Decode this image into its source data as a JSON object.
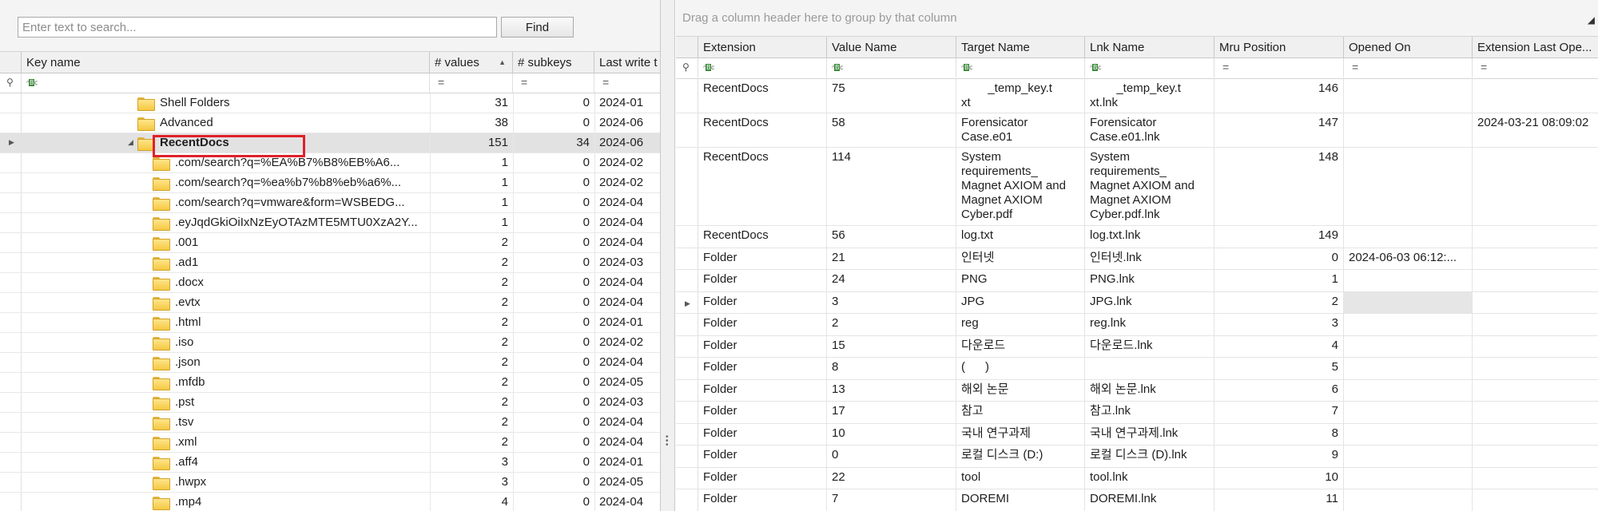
{
  "search": {
    "placeholder": "Enter text to search...",
    "find_label": "Find"
  },
  "left_grid": {
    "columns": [
      "Key name",
      "# values",
      "# subkeys",
      "Last write t"
    ],
    "rows": [
      {
        "name": "Shell Folders",
        "values": "31",
        "subkeys": "0",
        "date": "2024-01"
      },
      {
        "name": "Advanced",
        "values": "38",
        "subkeys": "0",
        "date": "2024-06"
      },
      {
        "name": "RecentDocs",
        "values": "151",
        "subkeys": "34",
        "date": "2024-06"
      },
      {
        "name": ".com/search?q=%EA%B7%B8%EB%A6...",
        "values": "1",
        "subkeys": "0",
        "date": "2024-02"
      },
      {
        "name": ".com/search?q=%ea%b7%b8%eb%a6%...",
        "values": "1",
        "subkeys": "0",
        "date": "2024-02"
      },
      {
        "name": ".com/search?q=vmware&form=WSBEDG...",
        "values": "1",
        "subkeys": "0",
        "date": "2024-04"
      },
      {
        "name": ".eyJqdGkiOiIxNzEyOTAzMTE5MTU0XzA2Y...",
        "values": "1",
        "subkeys": "0",
        "date": "2024-04"
      },
      {
        "name": ".001",
        "values": "2",
        "subkeys": "0",
        "date": "2024-04"
      },
      {
        "name": ".ad1",
        "values": "2",
        "subkeys": "0",
        "date": "2024-03"
      },
      {
        "name": ".docx",
        "values": "2",
        "subkeys": "0",
        "date": "2024-04"
      },
      {
        "name": ".evtx",
        "values": "2",
        "subkeys": "0",
        "date": "2024-04"
      },
      {
        "name": ".html",
        "values": "2",
        "subkeys": "0",
        "date": "2024-01"
      },
      {
        "name": ".iso",
        "values": "2",
        "subkeys": "0",
        "date": "2024-02"
      },
      {
        "name": ".json",
        "values": "2",
        "subkeys": "0",
        "date": "2024-04"
      },
      {
        "name": ".mfdb",
        "values": "2",
        "subkeys": "0",
        "date": "2024-05"
      },
      {
        "name": ".pst",
        "values": "2",
        "subkeys": "0",
        "date": "2024-03"
      },
      {
        "name": ".tsv",
        "values": "2",
        "subkeys": "0",
        "date": "2024-04"
      },
      {
        "name": ".xml",
        "values": "2",
        "subkeys": "0",
        "date": "2024-04"
      },
      {
        "name": ".aff4",
        "values": "3",
        "subkeys": "0",
        "date": "2024-01"
      },
      {
        "name": ".hwpx",
        "values": "3",
        "subkeys": "0",
        "date": "2024-05"
      },
      {
        "name": ".mp4",
        "values": "4",
        "subkeys": "0",
        "date": "2024-04"
      }
    ]
  },
  "right_grid": {
    "group_hint": "Drag a column header here to group by that column",
    "columns": [
      "Extension",
      "Value Name",
      "Target Name",
      "Lnk Name",
      "Mru Position",
      "Opened On",
      "Extension Last Ope..."
    ],
    "rows": [
      {
        "ext": "RecentDocs",
        "value": "75",
        "target": "        _temp_key.t\nxt",
        "lnk": "        _temp_key.t\nxt.lnk",
        "mru": "146",
        "opened": "",
        "last": ""
      },
      {
        "ext": "RecentDocs",
        "value": "58",
        "target": "Forensicator\nCase.e01",
        "lnk": "Forensicator\nCase.e01.lnk",
        "mru": "147",
        "opened": "",
        "last": "2024-03-21 08:09:02"
      },
      {
        "ext": "RecentDocs",
        "value": "114",
        "target": "System\nrequirements_\nMagnet AXIOM and\nMagnet AXIOM\nCyber.pdf",
        "lnk": "System\nrequirements_\nMagnet AXIOM and\nMagnet AXIOM\nCyber.pdf.lnk",
        "mru": "148",
        "opened": "",
        "last": ""
      },
      {
        "ext": "RecentDocs",
        "value": "56",
        "target": "log.txt",
        "lnk": "log.txt.lnk",
        "mru": "149",
        "opened": "",
        "last": ""
      },
      {
        "ext": "Folder",
        "value": "21",
        "target": "인터넷",
        "lnk": "인터넷.lnk",
        "mru": "0",
        "opened": "2024-06-03 06:12:...",
        "last": ""
      },
      {
        "ext": "Folder",
        "value": "24",
        "target": "PNG",
        "lnk": "PNG.lnk",
        "mru": "1",
        "opened": "",
        "last": ""
      },
      {
        "ext": "Folder",
        "value": "3",
        "target": "JPG",
        "lnk": "JPG.lnk",
        "mru": "2",
        "opened": "",
        "last": ""
      },
      {
        "ext": "Folder",
        "value": "2",
        "target": "reg",
        "lnk": "reg.lnk",
        "mru": "3",
        "opened": "",
        "last": ""
      },
      {
        "ext": "Folder",
        "value": "15",
        "target": "다운로드",
        "lnk": "다운로드.lnk",
        "mru": "4",
        "opened": "",
        "last": ""
      },
      {
        "ext": "Folder",
        "value": "8",
        "target": "(      )",
        "lnk": "",
        "mru": "5",
        "opened": "",
        "last": ""
      },
      {
        "ext": "Folder",
        "value": "13",
        "target": "해외 논문",
        "lnk": "해외 논문.lnk",
        "mru": "6",
        "opened": "",
        "last": ""
      },
      {
        "ext": "Folder",
        "value": "17",
        "target": "참고",
        "lnk": "참고.lnk",
        "mru": "7",
        "opened": "",
        "last": ""
      },
      {
        "ext": "Folder",
        "value": "10",
        "target": "국내 연구과제",
        "lnk": "국내 연구과제.lnk",
        "mru": "8",
        "opened": "",
        "last": ""
      },
      {
        "ext": "Folder",
        "value": "0",
        "target": "로컬 디스크 (D:)",
        "lnk": "로컬 디스크 (D).lnk",
        "mru": "9",
        "opened": "",
        "last": ""
      },
      {
        "ext": "Folder",
        "value": "22",
        "target": "tool",
        "lnk": "tool.lnk",
        "mru": "10",
        "opened": "",
        "last": ""
      },
      {
        "ext": "Folder",
        "value": "7",
        "target": "DOREMI",
        "lnk": "DOREMI.lnk",
        "mru": "11",
        "opened": "",
        "last": ""
      }
    ]
  },
  "colors": {
    "highlight_box": "#e0202a",
    "folder_icon": "#f5c842",
    "selected_row": "#e2e2e2"
  },
  "icons": [
    "folder-icon",
    "filter-pin-icon",
    "text-filter-icon",
    "equals-filter-icon",
    "sort-ascending-icon",
    "row-indicator-icon",
    "collapse-arrow-icon"
  ]
}
